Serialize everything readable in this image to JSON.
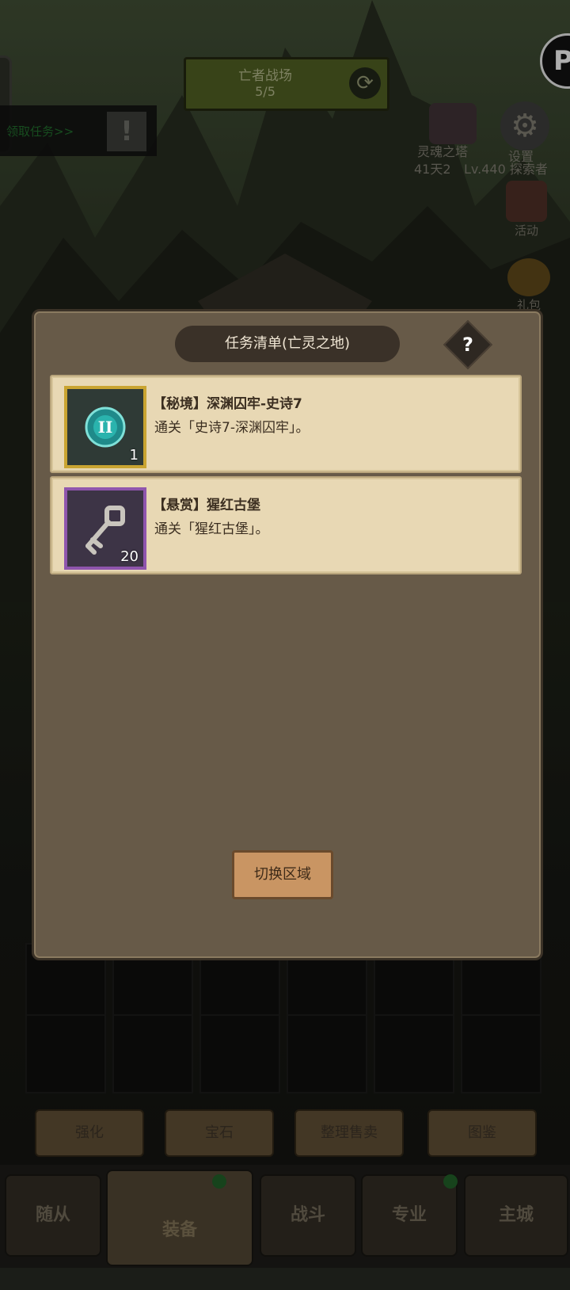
{
  "hud": {
    "battle_title": "亡者战场",
    "battle_progress": "5/5",
    "quest_link": "领取任务>>",
    "quest_alert": "!",
    "soul_tower_label": "灵魂之塔",
    "soul_tower_timer": "41天2",
    "settings_label": "设置",
    "explorer_text": "Lv.440 探索者",
    "activity_label": "活动",
    "gift_label": "礼包",
    "badge_letter": "P"
  },
  "dialog": {
    "title": "任务清单(亡灵之地)",
    "help": "?",
    "tasks": [
      {
        "title": "【秘境】深渊囚牢-史诗7",
        "desc": "通关「史诗7-深渊囚牢」。",
        "qty": "1",
        "icon": "epic-coin-icon",
        "frame_color": "#c9a431"
      },
      {
        "title": "【悬赏】猩红古堡",
        "desc": "通关「猩红古堡」。",
        "qty": "20",
        "icon": "key-icon",
        "frame_color": "#8f55ad"
      }
    ],
    "switch_label": "切换区域"
  },
  "actions": [
    "强化",
    "宝石",
    "整理售卖",
    "图鉴"
  ],
  "nav": [
    "随从",
    "装备",
    "战斗",
    "专业",
    "主城"
  ]
}
